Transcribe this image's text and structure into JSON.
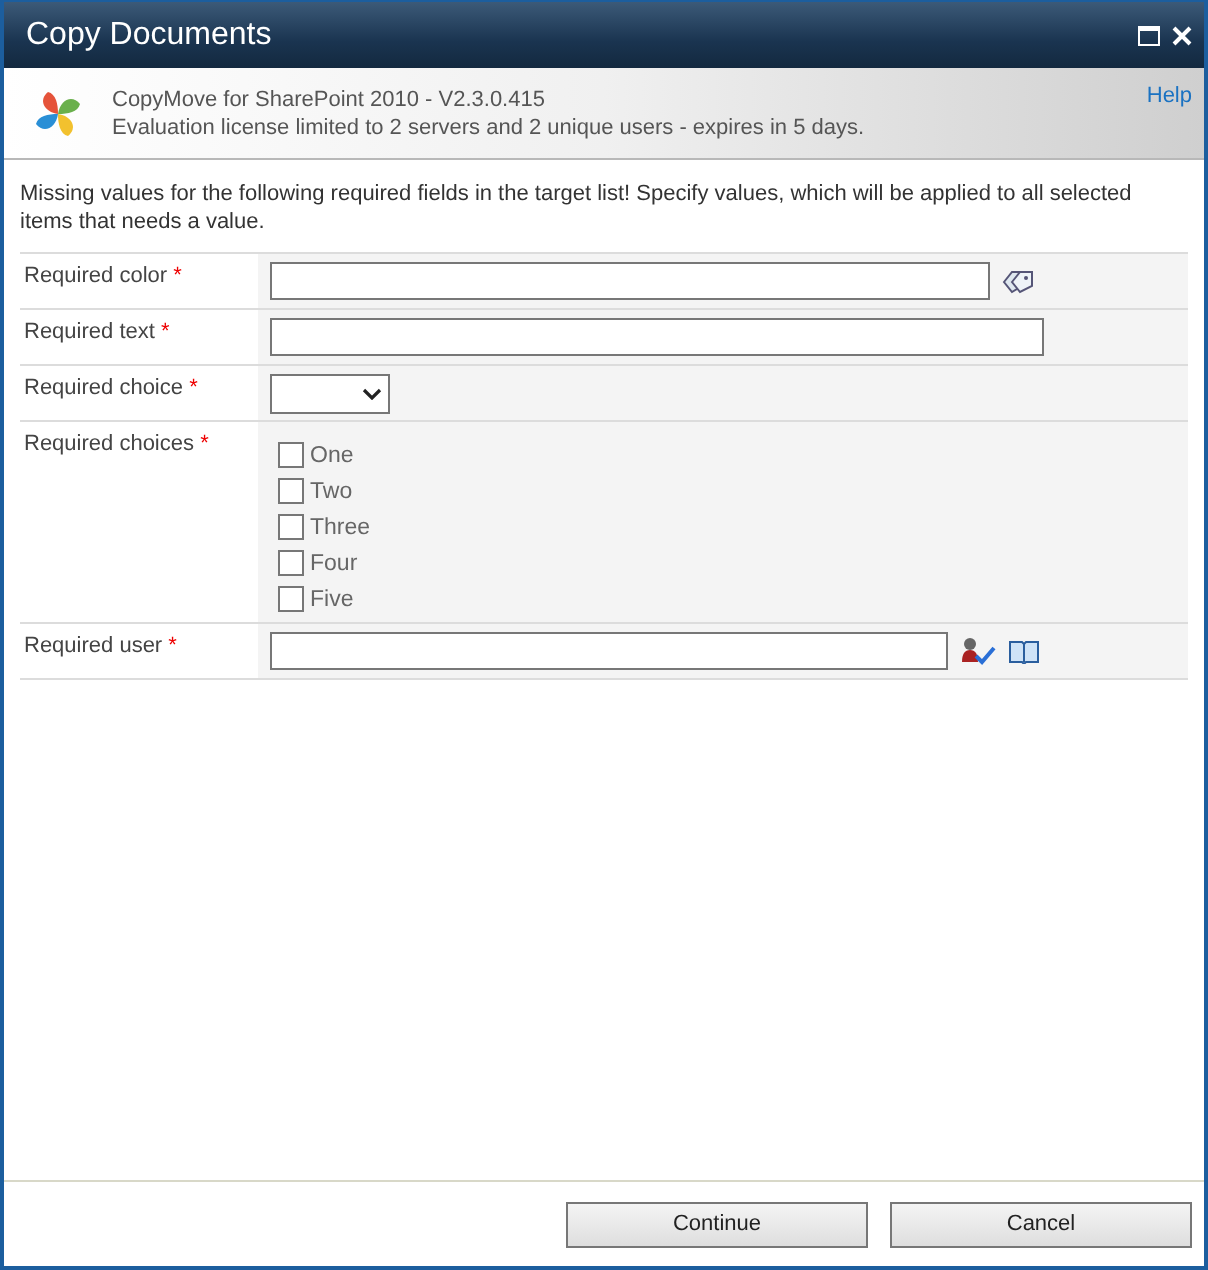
{
  "window": {
    "title": "Copy Documents"
  },
  "header": {
    "product": "CopyMove for SharePoint 2010 - V2.3.0.415",
    "license": "Evaluation license limited to 2 servers and 2 unique users - expires in 5 days.",
    "help": "Help"
  },
  "message": "Missing values for the following required fields in the target list! Specify values, which will be applied to all selected items that needs a value.",
  "fields": [
    {
      "label": "Required color",
      "required_mark": "*",
      "kind": "color"
    },
    {
      "label": "Required text",
      "required_mark": "*",
      "kind": "text"
    },
    {
      "label": "Required choice",
      "required_mark": "*",
      "kind": "select"
    },
    {
      "label": "Required choices",
      "required_mark": "*",
      "kind": "checkboxes",
      "options": [
        {
          "label": "One",
          "checked": false
        },
        {
          "label": "Two",
          "checked": false
        },
        {
          "label": "Three",
          "checked": false
        },
        {
          "label": "Four",
          "checked": false
        },
        {
          "label": "Five",
          "checked": false
        }
      ]
    },
    {
      "label": "Required user",
      "required_mark": "*",
      "kind": "user"
    }
  ],
  "buttons": [
    "Continue",
    "Cancel"
  ]
}
